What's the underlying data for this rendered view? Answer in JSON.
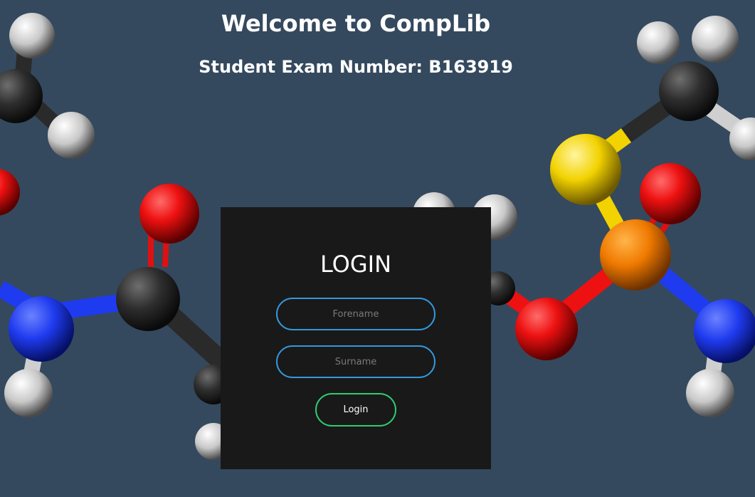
{
  "page": {
    "title": "Welcome to CompLib",
    "subtitle": "Student Exam Number: B163919"
  },
  "background": {
    "image": "molecule-ball-and-stick",
    "color": "#34495e"
  },
  "login": {
    "heading": "LOGIN",
    "forename_placeholder": "Forename",
    "forename_value": "",
    "surname_placeholder": "Surname",
    "surname_value": "",
    "button_label": "Login",
    "field_border_color": "#3498db",
    "button_border_color": "#2ecc71",
    "panel_color": "#191919"
  }
}
